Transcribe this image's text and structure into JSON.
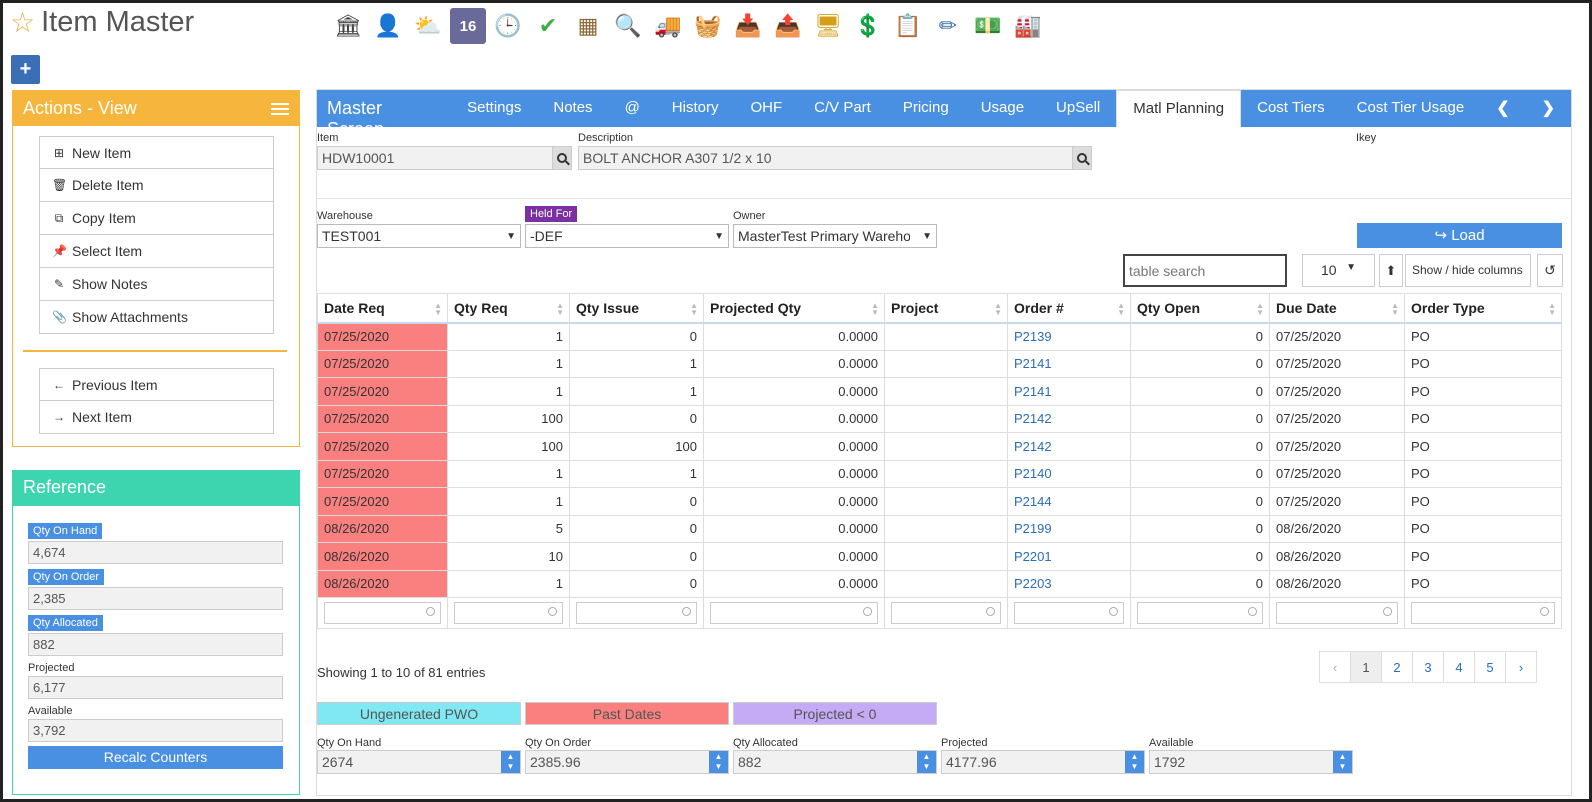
{
  "page": {
    "title": "Item Master"
  },
  "toolbar_icons": [
    {
      "name": "bank-icon",
      "glyph": "🏛"
    },
    {
      "name": "person-icon",
      "glyph": "👤"
    },
    {
      "name": "weather-icon",
      "glyph": "⛅"
    },
    {
      "name": "calendar-16-icon",
      "glyph": "16"
    },
    {
      "name": "clock-icon",
      "glyph": "🕒"
    },
    {
      "name": "checkmark-icon",
      "glyph": "✔"
    },
    {
      "name": "spreadsheet-icon",
      "glyph": "▦"
    },
    {
      "name": "magnifier-icon",
      "glyph": "🔍"
    },
    {
      "name": "truck-icon",
      "glyph": "🚚"
    },
    {
      "name": "basket-icon",
      "glyph": "🧺"
    },
    {
      "name": "inbox-download-icon",
      "glyph": "📥"
    },
    {
      "name": "outbox-upload-icon",
      "glyph": "📤"
    },
    {
      "name": "computer-stack-icon",
      "glyph": "🖥"
    },
    {
      "name": "dollar-chat-icon",
      "glyph": "💲"
    },
    {
      "name": "clipboard-icon",
      "glyph": "📋"
    },
    {
      "name": "tag-pencil-icon",
      "glyph": "✏"
    },
    {
      "name": "money-icon",
      "glyph": "💵"
    },
    {
      "name": "factory-icon",
      "glyph": "🏭"
    }
  ],
  "actions": {
    "title": "Actions - View",
    "items": [
      {
        "label": "New Item",
        "icon": "⊞"
      },
      {
        "label": "Delete Item",
        "icon": "🗑"
      },
      {
        "label": "Copy Item",
        "icon": "⧉"
      },
      {
        "label": "Select Item",
        "icon": "📌"
      },
      {
        "label": "Show Notes",
        "icon": "✎"
      },
      {
        "label": "Show Attachments",
        "icon": "📎"
      }
    ],
    "nav": [
      {
        "label": "Previous Item",
        "icon": "←"
      },
      {
        "label": "Next Item",
        "icon": "→"
      }
    ]
  },
  "reference": {
    "title": "Reference",
    "qty_on_hand_label": "Qty On Hand",
    "qty_on_hand": "4,674",
    "qty_on_order_label": "Qty On Order",
    "qty_on_order": "2,385",
    "qty_allocated_label": "Qty Allocated",
    "qty_allocated": "882",
    "projected_label": "Projected",
    "projected": "6,177",
    "available_label": "Available",
    "available": "3,792",
    "recalc_label": "Recalc Counters"
  },
  "master": {
    "title": "Master Screen",
    "tabs": [
      "Settings",
      "Notes",
      "@",
      "History",
      "OHF",
      "C/V Part",
      "Pricing",
      "Usage",
      "UpSell",
      "Matl Planning",
      "Cost Tiers",
      "Cost Tier Usage"
    ],
    "active_tab": "Matl Planning",
    "item_label": "Item",
    "item_value": "HDW10001",
    "description_label": "Description",
    "description_value": "BOLT ANCHOR A307 1/2 x 10",
    "ikey_label": "Ikey",
    "warehouse_label": "Warehouse",
    "warehouse_value": "TEST001",
    "held_for_label": "Held For",
    "held_for_value": "-DEF",
    "owner_label": "Owner",
    "owner_value": "MasterTest Primary Wareho",
    "load_label": "Load",
    "table_search_placeholder": "table search",
    "page_size": "10",
    "show_hide_label": "Show / hide columns"
  },
  "table": {
    "columns": [
      "Date Req",
      "Qty Req",
      "Qty Issue",
      "Projected Qty",
      "Project",
      "Order #",
      "Qty Open",
      "Due Date",
      "Order Type"
    ],
    "rows": [
      [
        "07/25/2020",
        "1",
        "0",
        "0.0000",
        "",
        "P2139",
        "0",
        "07/25/2020",
        "PO"
      ],
      [
        "07/25/2020",
        "1",
        "1",
        "0.0000",
        "",
        "P2141",
        "0",
        "07/25/2020",
        "PO"
      ],
      [
        "07/25/2020",
        "1",
        "1",
        "0.0000",
        "",
        "P2141",
        "0",
        "07/25/2020",
        "PO"
      ],
      [
        "07/25/2020",
        "100",
        "0",
        "0.0000",
        "",
        "P2142",
        "0",
        "07/25/2020",
        "PO"
      ],
      [
        "07/25/2020",
        "100",
        "100",
        "0.0000",
        "",
        "P2142",
        "0",
        "07/25/2020",
        "PO"
      ],
      [
        "07/25/2020",
        "1",
        "1",
        "0.0000",
        "",
        "P2140",
        "0",
        "07/25/2020",
        "PO"
      ],
      [
        "07/25/2020",
        "1",
        "0",
        "0.0000",
        "",
        "P2144",
        "0",
        "07/25/2020",
        "PO"
      ],
      [
        "08/26/2020",
        "5",
        "0",
        "0.0000",
        "",
        "P2199",
        "0",
        "08/26/2020",
        "PO"
      ],
      [
        "08/26/2020",
        "10",
        "0",
        "0.0000",
        "",
        "P2201",
        "0",
        "08/26/2020",
        "PO"
      ],
      [
        "08/26/2020",
        "1",
        "0",
        "0.0000",
        "",
        "P2203",
        "0",
        "08/26/2020",
        "PO"
      ]
    ],
    "showing": "Showing 1 to 10 of 81 entries",
    "pages": [
      "‹",
      "1",
      "2",
      "3",
      "4",
      "5",
      "›"
    ]
  },
  "legend": {
    "ungenerated": "Ungenerated PWO",
    "ungenerated_color": "#7fe8f2",
    "past_dates": "Past Dates",
    "past_dates_color": "#fa8080",
    "projected_neg": "Projected < 0",
    "projected_neg_color": "#c5aaf5"
  },
  "totals": {
    "qty_on_hand_label": "Qty On Hand",
    "qty_on_hand": "2674",
    "qty_on_order_label": "Qty On Order",
    "qty_on_order": "2385.96",
    "qty_allocated_label": "Qty Allocated",
    "qty_allocated": "882",
    "projected_label": "Projected",
    "projected": "4177.96",
    "available_label": "Available",
    "available": "1792"
  }
}
